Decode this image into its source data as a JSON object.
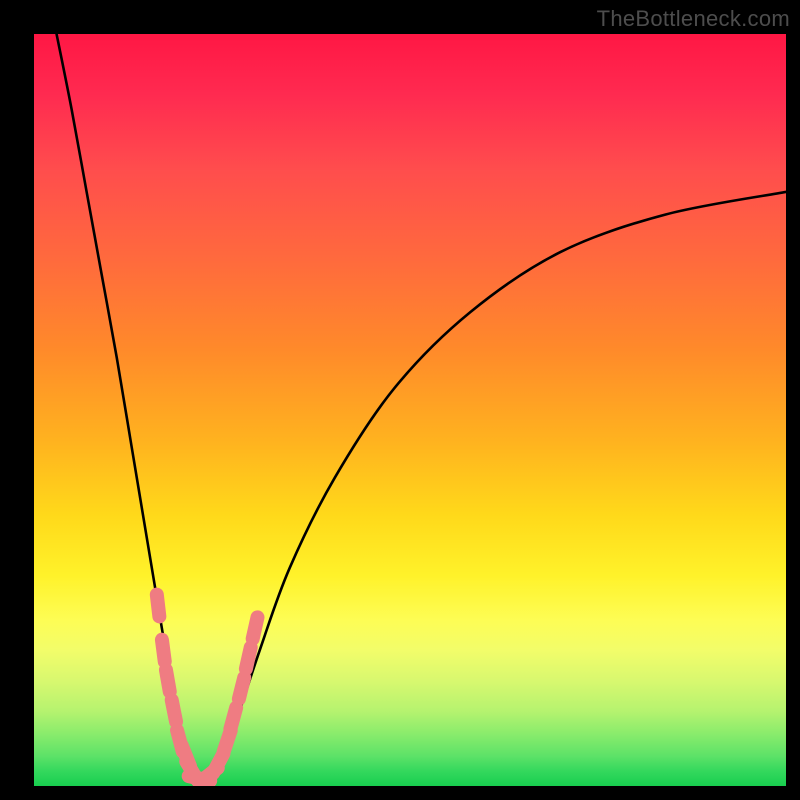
{
  "watermark": "TheBottleneck.com",
  "chart_data": {
    "type": "line",
    "title": "",
    "xlabel": "",
    "ylabel": "",
    "xlim": [
      0,
      100
    ],
    "ylim": [
      0,
      100
    ],
    "series": [
      {
        "name": "bottleneck-curve",
        "x": [
          3,
          5,
          7,
          9,
          11,
          13,
          15,
          17,
          18,
          19,
          20,
          21,
          22,
          23,
          24,
          25,
          27,
          30,
          34,
          40,
          48,
          58,
          70,
          84,
          100
        ],
        "values": [
          100,
          90,
          79,
          68,
          57,
          45,
          33,
          21,
          15,
          10,
          6,
          3,
          1,
          1,
          2,
          4,
          9,
          18,
          29,
          41,
          53,
          63,
          71,
          76,
          79
        ]
      }
    ],
    "markers": {
      "name": "highlighted-range",
      "color": "#ef7c82",
      "points": [
        {
          "x": 16.5,
          "y": 24
        },
        {
          "x": 17.2,
          "y": 18
        },
        {
          "x": 17.8,
          "y": 14
        },
        {
          "x": 18.6,
          "y": 10
        },
        {
          "x": 19.4,
          "y": 6
        },
        {
          "x": 20.2,
          "y": 4
        },
        {
          "x": 21.0,
          "y": 2
        },
        {
          "x": 22.0,
          "y": 1
        },
        {
          "x": 23.3,
          "y": 1.5
        },
        {
          "x": 24.5,
          "y": 3
        },
        {
          "x": 25.7,
          "y": 6
        },
        {
          "x": 26.5,
          "y": 9
        },
        {
          "x": 27.6,
          "y": 13
        },
        {
          "x": 28.5,
          "y": 17
        },
        {
          "x": 29.4,
          "y": 21
        }
      ]
    },
    "background_gradient": {
      "top": "#ff1744",
      "mid": "#ffe838",
      "bottom": "#18ce4f"
    }
  }
}
